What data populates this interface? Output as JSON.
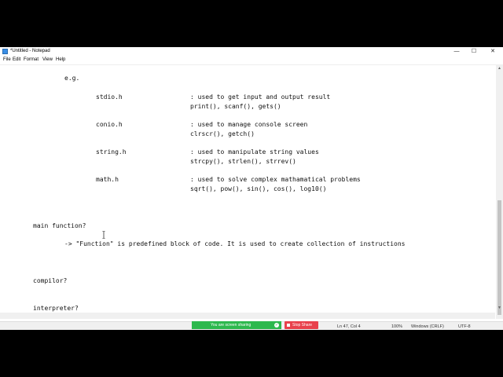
{
  "window": {
    "title": "*Untitled - Notepad",
    "controls": {
      "minimize": "—",
      "maximize": "☐",
      "close": "✕"
    }
  },
  "menu": {
    "items": [
      "File",
      "Edit",
      "Format",
      "View",
      "Help"
    ]
  },
  "editor": {
    "lines": [
      "e.g.",
      "stdio.h",
      ": used to get input and output result",
      "print(), scanf(), gets()",
      "conio.h",
      ": used to manage console screen",
      "clrscr(), getch()",
      "string.h",
      ": used to manipulate string values",
      "strcpy(), strlen(), strrev()",
      "math.h",
      ": used to solve complex mathamatical problems",
      "sqrt(), pow(), sin(), cos(), log10()",
      "main function?",
      "-> \"Function\" is predefined block of code. It is used to create collection of instructions",
      "compilor?",
      "interpreter?"
    ]
  },
  "screen_share": {
    "label": "You are screen sharing",
    "stop_label": "Stop Share"
  },
  "status": {
    "position": "Ln 47, Col 4",
    "zoom": "100%",
    "line_ending": "Windows (CRLF)",
    "encoding": "UTF-8"
  }
}
